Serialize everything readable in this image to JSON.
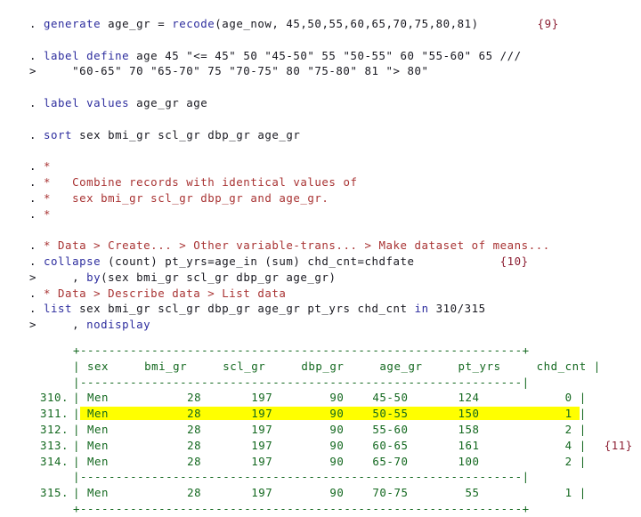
{
  "window": {
    "title": "Stata Session Log",
    "background": "#ffffff",
    "colors": {
      "keyword": "#2d2d9e",
      "plain": "#17171f",
      "comment": "#a83232",
      "note": "#8c1f33",
      "table": "#13681f",
      "highlight": "#ffff00"
    }
  },
  "commands": {
    "generate": {
      "prompt": ". ",
      "keyword": "generate",
      "args": " age_gr = ",
      "keyword2": "recode",
      "args2": "(age_now, 45,50,55,60,65,70,75,80,81)",
      "note": "{9}"
    },
    "label_define": {
      "prompt": ". ",
      "keyword": "label define",
      "args": " age 45 \"<= 45\" 50 \"45-50\" 55 \"50-55\" 60 \"55-60\" 65 ///",
      "continuation_prompt": ">     ",
      "continuation": "\"60-65\" 70 \"65-70\" 75 \"70-75\" 80 \"75-80\" 81 \"> 80\""
    },
    "label_values": {
      "prompt": ". ",
      "keyword": "label values",
      "args": " age_gr age"
    },
    "sort": {
      "prompt": ". ",
      "keyword": "sort",
      "args": " sex bmi_gr scl_gr dbp_gr age_gr"
    },
    "collapse": {
      "prompt": ". ",
      "keyword": "collapse",
      "args": " (count) pt_yrs=age_in (sum) chd_cnt=chdfate",
      "note": "{10}",
      "continuation_prompt": ">     ",
      "continuation_comma": ", ",
      "continuation_keyword": "by",
      "continuation_args": "(sex bmi_gr scl_gr dbp_gr age_gr)"
    },
    "list": {
      "prompt": ". ",
      "keyword": "list",
      "args": " sex bmi_gr scl_gr dbp_gr age_gr pt_yrs chd_cnt ",
      "keyword_in": "in",
      "args_range": " 310/315",
      "continuation_prompt": ">     ",
      "continuation_comma": ", ",
      "continuation_keyword": "nodisplay"
    }
  },
  "comments": {
    "star_1": "*",
    "block_1": "*   Combine records with identical values of",
    "block_2": "*   sex bmi_gr scl_gr dbp_gr and age_gr.",
    "star_2": "*",
    "menu_path_create": "* Data > Create... > Other variable-trans... > Make dataset of means...",
    "menu_path_list": "* Data > Describe data > List data",
    "prompt": ". "
  },
  "table": {
    "top_border": "+--------------------------------------------------------------+",
    "mid_border": "|--------------------------------------------------------------|",
    "bottom_border": "+--------------------------------------------------------------+",
    "header": "| sex     bmi_gr     scl_gr     dbp_gr     age_gr     pt_yrs     chd_cnt |",
    "columns": [
      "sex",
      "bmi_gr",
      "scl_gr",
      "dbp_gr",
      "age_gr",
      "pt_yrs",
      "chd_cnt"
    ],
    "rows": [
      {
        "num": "310.",
        "sex": "Men",
        "bmi_gr": "28",
        "scl_gr": "197",
        "dbp_gr": "90",
        "age_gr": "45-50",
        "pt_yrs": "124",
        "chd_cnt": "0",
        "highlight": false,
        "note": ""
      },
      {
        "num": "311.",
        "sex": "Men",
        "bmi_gr": "28",
        "scl_gr": "197",
        "dbp_gr": "90",
        "age_gr": "50-55",
        "pt_yrs": "150",
        "chd_cnt": "1",
        "highlight": true,
        "note": ""
      },
      {
        "num": "312.",
        "sex": "Men",
        "bmi_gr": "28",
        "scl_gr": "197",
        "dbp_gr": "90",
        "age_gr": "55-60",
        "pt_yrs": "158",
        "chd_cnt": "2",
        "highlight": false,
        "note": ""
      },
      {
        "num": "313.",
        "sex": "Men",
        "bmi_gr": "28",
        "scl_gr": "197",
        "dbp_gr": "90",
        "age_gr": "60-65",
        "pt_yrs": "161",
        "chd_cnt": "4",
        "highlight": false,
        "note": "{11}"
      },
      {
        "num": "314.",
        "sex": "Men",
        "bmi_gr": "28",
        "scl_gr": "197",
        "dbp_gr": "90",
        "age_gr": "65-70",
        "pt_yrs": "100",
        "chd_cnt": "2",
        "highlight": false,
        "note": ""
      },
      {
        "num": "315.",
        "sex": "Men",
        "bmi_gr": "28",
        "scl_gr": "197",
        "dbp_gr": "90",
        "age_gr": "70-75",
        "pt_yrs": "55",
        "chd_cnt": "1",
        "highlight": false,
        "note": ""
      }
    ]
  }
}
